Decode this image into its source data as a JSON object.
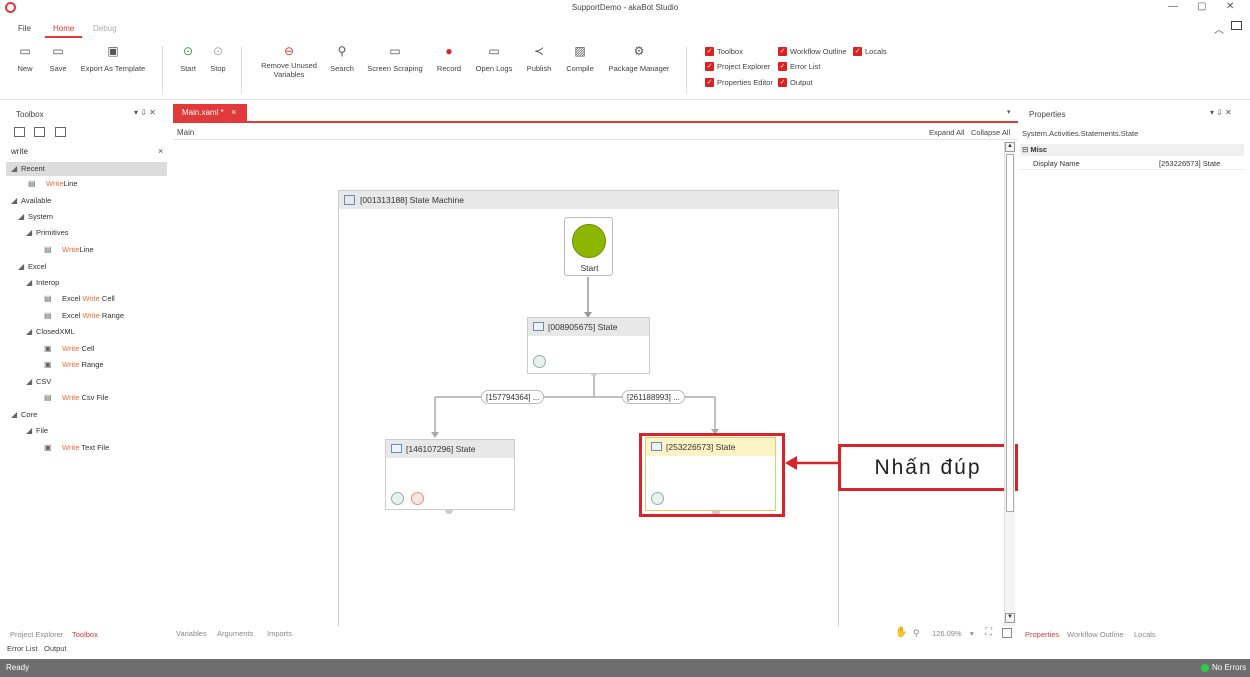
{
  "window": {
    "title": "SupportDemo - akaBot Studio"
  },
  "ribbon_tabs": [
    "File",
    "Home",
    "Debug"
  ],
  "ribbon": {
    "new": "New",
    "save": "Save",
    "export": "Export As Template",
    "start": "Start",
    "stop": "Stop",
    "remove_unused_1": "Remove Unused",
    "remove_unused_2": "Variables",
    "search": "Search",
    "screen_scraping": "Screen Scraping",
    "record": "Record",
    "open_logs": "Open Logs",
    "publish": "Publish",
    "compile": "Compile",
    "package_manager": "Package Manager"
  },
  "panel_toggles": {
    "toolbox": "Toolbox",
    "workflow_outline": "Workflow Outline",
    "locals": "Locals",
    "project_explorer": "Project Explorer",
    "error_list": "Error List",
    "properties_editor": "Properties Editor",
    "output": "Output"
  },
  "toolbox": {
    "title": "Toolbox",
    "search_value": "write",
    "clear": "×",
    "recent": "Recent",
    "available": "Available",
    "system": "System",
    "primitives": "Primitives",
    "excel": "Excel",
    "interop": "Interop",
    "closedxml": "ClosedXML",
    "csv": "CSV",
    "core": "Core",
    "file": "File",
    "write": "Write",
    "line": "Line",
    "excel_prefix": "Excel ",
    "cell": " Cell",
    "range": " Range",
    "csv_file": " Csv File",
    "text_file": " Text File"
  },
  "left_bottom_tabs": {
    "project_explorer": "Project Explorer",
    "toolbox": "Toolbox",
    "error_list": "Error List",
    "output": "Output"
  },
  "doc": {
    "tab": "Main.xaml *",
    "close": "×",
    "breadcrumb": "Main",
    "expand_all": "Expand All",
    "collapse_all": "Collapse All"
  },
  "canvas": {
    "machine_title": "[001313188] State Machine",
    "start_label": "Start",
    "state1": "[008905675] State",
    "state2": "[146107296] State",
    "state3": "[253226573] State",
    "trans1": "[157794364] ...",
    "trans2": "[261188993] ..."
  },
  "annotation": {
    "text": "Nhấn đúp",
    "color": "#d9232a"
  },
  "designer_bottom": {
    "variables": "Variables",
    "arguments": "Arguments",
    "imports": "Imports",
    "zoom": "126.09%"
  },
  "properties": {
    "title": "Properties",
    "type": "System.Activities.Statements.State",
    "category": "Misc",
    "display_name_label": "Display Name",
    "display_name_value": "[253226573] State"
  },
  "right_bottom_tabs": {
    "properties": "Properties",
    "workflow_outline": "Workflow Outline",
    "locals": "Locals"
  },
  "status": {
    "left": "Ready",
    "right": "No Errors"
  },
  "colors": {
    "accent": "#e03a3a",
    "status_bar": "#6e6e6e",
    "start_node": "#8db600",
    "selected_state": "#fdf3c4"
  }
}
